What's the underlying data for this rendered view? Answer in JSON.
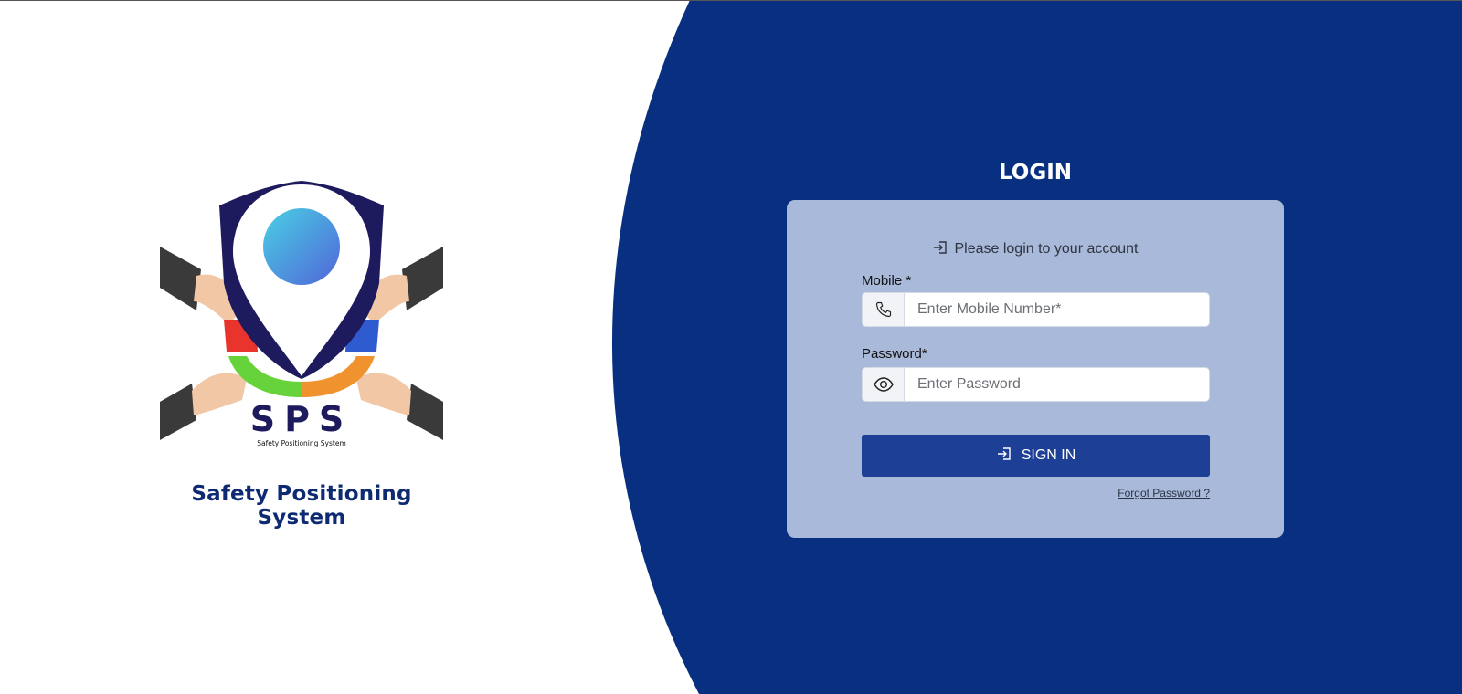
{
  "brand": {
    "logo_text": "SPS",
    "logo_subtext": "Safety Positioning System",
    "name": "Safety Positioning System"
  },
  "login": {
    "title": "LOGIN",
    "subtitle": "Please login to your account",
    "mobile": {
      "label": "Mobile *",
      "placeholder": "Enter Mobile Number*",
      "icon": "phone-icon"
    },
    "password": {
      "label": "Password*",
      "placeholder": "Enter Password",
      "icon": "eye-icon"
    },
    "signin_label": "SIGN IN",
    "forgot_label": "Forgot Password ?"
  },
  "colors": {
    "panel_blue": "#082f80",
    "card": "#a9b9da",
    "button": "#1d3f96",
    "brand_text": "#0d2a73"
  }
}
